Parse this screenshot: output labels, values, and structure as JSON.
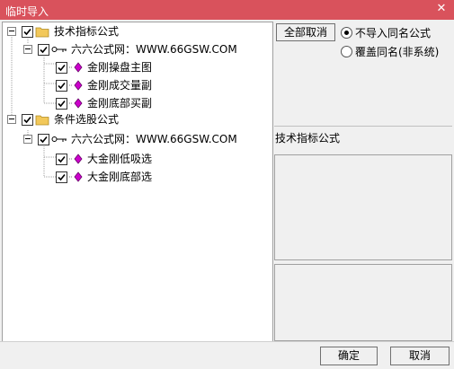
{
  "window": {
    "title": "临时导入",
    "close_label": "✕"
  },
  "tree": {
    "group1": {
      "label": "技术指标公式",
      "source_label": "六六公式网：WWW.66GSW.COM",
      "items": [
        "金刚操盘主图",
        "金刚成交量副",
        "金刚底部买副"
      ]
    },
    "group2": {
      "label": "条件选股公式",
      "source_label": "六六公式网：WWW.66GSW.COM",
      "items": [
        "大金刚低吸选",
        "大金刚底部选"
      ]
    }
  },
  "options": {
    "deselect_all_label": "全部取消",
    "radio_no_import": "不导入同名公式",
    "radio_overwrite": "覆盖同名(非系统)",
    "selected": "no_import"
  },
  "info_panel": {
    "label": "技术指标公式"
  },
  "footer": {
    "ok_label": "确定",
    "cancel_label": "取消"
  },
  "colors": {
    "titlebar": "#d9525c",
    "folder": "#f2c85a",
    "gem": "#cc00cc"
  }
}
